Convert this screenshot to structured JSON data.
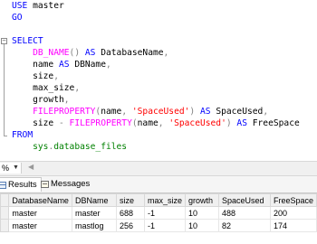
{
  "editor": {
    "lines": [
      [
        {
          "t": "USE ",
          "c": "kw"
        },
        {
          "t": "master",
          "c": "plain"
        }
      ],
      [
        {
          "t": "GO",
          "c": "kw"
        }
      ],
      [],
      [
        {
          "t": "SELECT",
          "c": "kw"
        }
      ],
      [
        {
          "t": "    ",
          "c": "plain"
        },
        {
          "t": "DB_NAME",
          "c": "fn"
        },
        {
          "t": "() ",
          "c": "op"
        },
        {
          "t": "AS",
          "c": "kw"
        },
        {
          "t": " DatabaseName",
          "c": "plain"
        },
        {
          "t": ",",
          "c": "op"
        }
      ],
      [
        {
          "t": "    name ",
          "c": "plain"
        },
        {
          "t": "AS",
          "c": "kw"
        },
        {
          "t": " DBName",
          "c": "plain"
        },
        {
          "t": ",",
          "c": "op"
        }
      ],
      [
        {
          "t": "    size",
          "c": "plain"
        },
        {
          "t": ",",
          "c": "op"
        }
      ],
      [
        {
          "t": "    max_size",
          "c": "plain"
        },
        {
          "t": ",",
          "c": "op"
        }
      ],
      [
        {
          "t": "    growth",
          "c": "plain"
        },
        {
          "t": ",",
          "c": "op"
        }
      ],
      [
        {
          "t": "    ",
          "c": "plain"
        },
        {
          "t": "FILEPROPERTY",
          "c": "fn"
        },
        {
          "t": "(",
          "c": "op"
        },
        {
          "t": "name",
          "c": "plain"
        },
        {
          "t": ", ",
          "c": "op"
        },
        {
          "t": "'SpaceUsed'",
          "c": "str"
        },
        {
          "t": ") ",
          "c": "op"
        },
        {
          "t": "AS",
          "c": "kw"
        },
        {
          "t": " SpaceUsed",
          "c": "plain"
        },
        {
          "t": ",",
          "c": "op"
        }
      ],
      [
        {
          "t": "    size ",
          "c": "plain"
        },
        {
          "t": "- ",
          "c": "op"
        },
        {
          "t": "FILEPROPERTY",
          "c": "fn"
        },
        {
          "t": "(",
          "c": "op"
        },
        {
          "t": "name",
          "c": "plain"
        },
        {
          "t": ", ",
          "c": "op"
        },
        {
          "t": "'SpaceUsed'",
          "c": "str"
        },
        {
          "t": ") ",
          "c": "op"
        },
        {
          "t": "AS",
          "c": "kw"
        },
        {
          "t": " FreeSpace",
          "c": "plain"
        }
      ],
      [
        {
          "t": "FROM",
          "c": "kw"
        }
      ],
      [
        {
          "t": "    ",
          "c": "plain"
        },
        {
          "t": "sys",
          "c": "sys"
        },
        {
          "t": ".",
          "c": "op"
        },
        {
          "t": "database_files",
          "c": "sys"
        }
      ]
    ]
  },
  "zoom": {
    "value": "%"
  },
  "tabs": {
    "results": "Results",
    "messages": "Messages"
  },
  "results": {
    "columns": [
      "DatabaseName",
      "DBName",
      "size",
      "max_size",
      "growth",
      "SpaceUsed",
      "FreeSpace"
    ],
    "rows": [
      [
        "master",
        "master",
        "688",
        "-1",
        "10",
        "488",
        "200"
      ],
      [
        "master",
        "mastlog",
        "256",
        "-1",
        "10",
        "82",
        "174"
      ]
    ]
  },
  "colors": {
    "keyword": "#0000ff",
    "function": "#ff00ff",
    "string": "#ff0000",
    "system": "#008000",
    "operator": "#808080"
  }
}
